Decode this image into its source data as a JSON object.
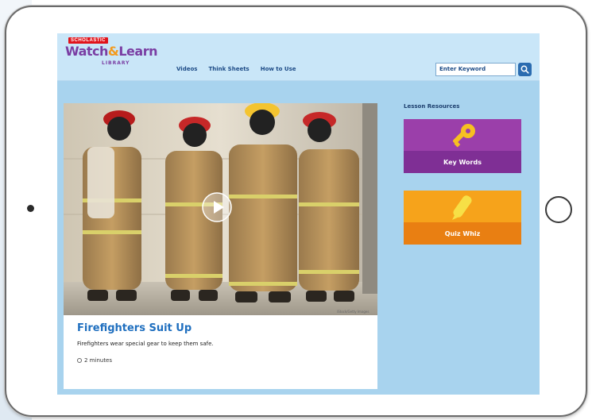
{
  "logo": {
    "brand": "SCHOLASTIC",
    "title_a": "Watch",
    "title_amp": "&",
    "title_b": "Learn",
    "subtitle": "LIBRARY"
  },
  "nav": {
    "items": [
      "Videos",
      "Think Sheets",
      "How to Use"
    ]
  },
  "search": {
    "placeholder": "Enter Keyword"
  },
  "video": {
    "title": "Firefighters Suit Up",
    "description": "Firefighters wear special gear to keep them safe.",
    "duration": "2 minutes",
    "credit": "iStock/Getty Images"
  },
  "resources": {
    "heading": "Lesson Resources",
    "items": [
      {
        "label": "Key Words",
        "icon": "key-icon",
        "color_top": "#9b3faa",
        "color_bottom": "#7f2f95"
      },
      {
        "label": "Quiz Whiz",
        "icon": "pencil-icon",
        "color_top": "#f6a31b",
        "color_bottom": "#e97f12"
      }
    ]
  },
  "colors": {
    "screen_bg": "#a8d3ee",
    "header_bg": "#c9e6f8",
    "title_blue": "#1f6fbf",
    "brand_red": "#e0131b",
    "logo_purple": "#7a3ea3"
  }
}
